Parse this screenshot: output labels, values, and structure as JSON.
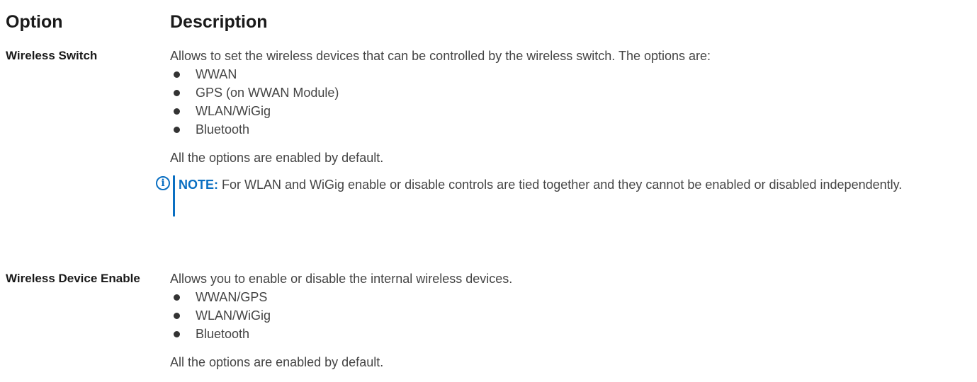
{
  "table": {
    "header": {
      "option": "Option",
      "description": "Description"
    },
    "rows": [
      {
        "option": "Wireless Switch",
        "intro": "Allows to set the wireless devices that can be controlled by the wireless switch. The options are:",
        "items": [
          "WWAN",
          "GPS (on WWAN Module)",
          "WLAN/WiGig",
          "Bluetooth"
        ],
        "footer": "All the options are enabled by default.",
        "note": {
          "label": "NOTE:",
          "text": "For WLAN and WiGig enable or disable controls are tied together and they cannot be enabled or disabled independently."
        }
      },
      {
        "option": "Wireless Device Enable",
        "intro": "Allows you to enable or disable the internal wireless devices.",
        "items": [
          "WWAN/GPS",
          "WLAN/WiGig",
          "Bluetooth"
        ],
        "footer": "All the options are enabled by default."
      }
    ]
  },
  "colors": {
    "accent": "#0a6fc2",
    "text": "#444444",
    "heading": "#1a1a1a"
  }
}
